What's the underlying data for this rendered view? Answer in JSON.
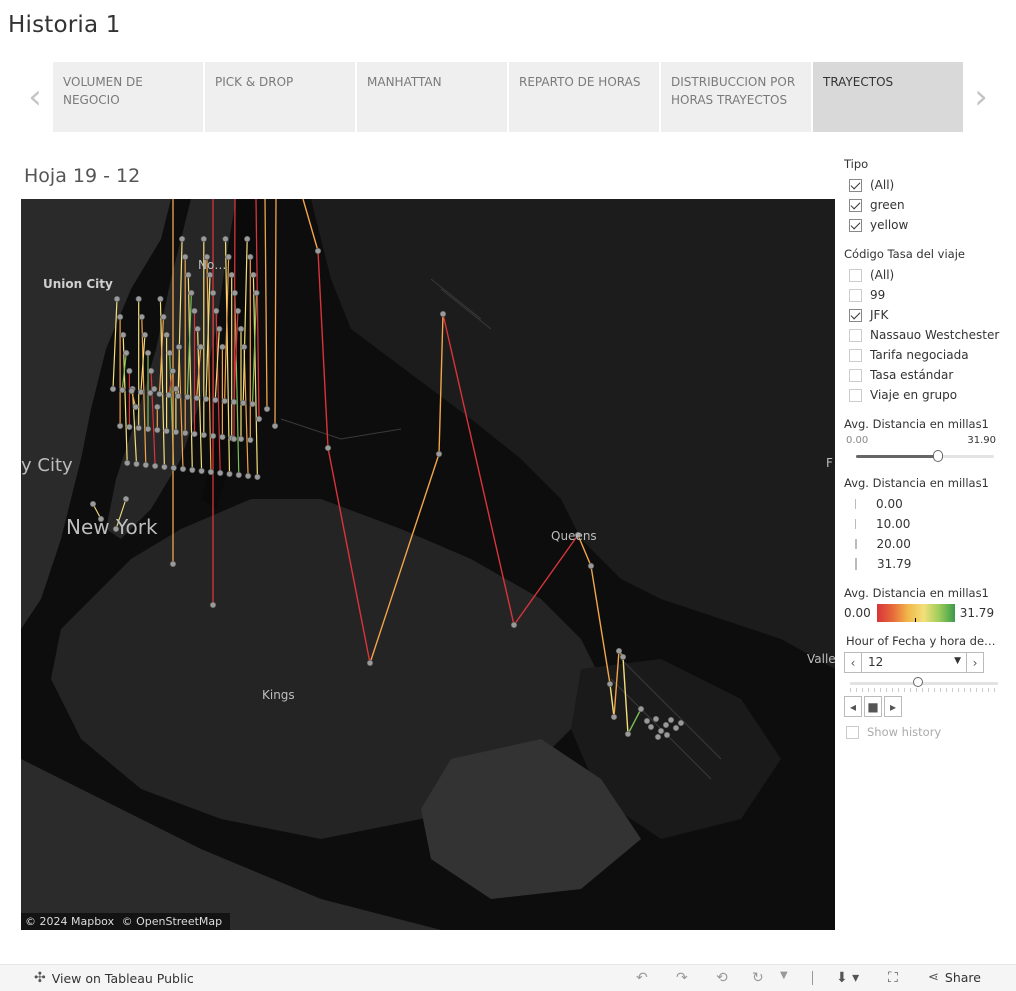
{
  "story": {
    "title": "Historia 1"
  },
  "nav": {
    "prev_icon": "chevron-left-icon",
    "next_icon": "chevron-right-icon"
  },
  "tabs": [
    {
      "label": "VOLUMEN DE NEGOCIO",
      "active": false
    },
    {
      "label": "PICK & DROP",
      "active": false
    },
    {
      "label": "MANHATTAN",
      "active": false
    },
    {
      "label": "REPARTO DE HORAS",
      "active": false
    },
    {
      "label": "DISTRIBUCCION POR HORAS TRAYECTOS",
      "active": false
    },
    {
      "label": "TRAYECTOS",
      "active": true
    }
  ],
  "sheet": {
    "title": "Hoja 19 - 12"
  },
  "map": {
    "labels": {
      "union_city": "Union City",
      "city": "y City",
      "new_york": "New York",
      "queens": "Queens",
      "kings": "Kings",
      "valle": "Valle",
      "f": "F",
      "north": "No…"
    },
    "attribution": {
      "mapbox": "© 2024 Mapbox",
      "osm": "© OpenStreetMap"
    },
    "colors": {
      "background": "#0d0d0d",
      "land": "#2a2a2a",
      "water": "#000000",
      "red": "#d9343a",
      "orange": "#f2a54a",
      "yellow": "#f3e07a",
      "green": "#7cbf55",
      "point": "#9a9a9a"
    }
  },
  "filters": {
    "tipo": {
      "heading": "Tipo",
      "options": [
        {
          "label": "(All)",
          "checked": true
        },
        {
          "label": "green",
          "checked": true
        },
        {
          "label": "yellow",
          "checked": true
        }
      ]
    },
    "codigo": {
      "heading": "Código Tasa del viaje",
      "options": [
        {
          "label": "(All)",
          "checked": false
        },
        {
          "label": "99",
          "checked": false
        },
        {
          "label": "JFK",
          "checked": true
        },
        {
          "label": "Nassauo Westchester",
          "checked": false
        },
        {
          "label": "Tarifa negociada",
          "checked": false
        },
        {
          "label": "Tasa estándar",
          "checked": false
        },
        {
          "label": "Viaje en grupo",
          "checked": false
        }
      ]
    },
    "distancia_range": {
      "heading": "Avg. Distancia en millas1",
      "min": "0.00",
      "max": "31.90",
      "value_fraction": 0.63
    },
    "size_legend": {
      "heading": "Avg. Distancia en millas1",
      "items": [
        "0.00",
        "10.00",
        "20.00",
        "31.79"
      ]
    },
    "color_legend": {
      "heading": "Avg. Distancia en millas1",
      "min": "0.00",
      "max": "31.79"
    },
    "hour": {
      "heading": "Hour of Fecha y hora de…",
      "value": "12",
      "slider_fraction": 0.5,
      "show_history": "Show history"
    }
  },
  "toolbar": {
    "view_label": "View on Tableau Public",
    "share_label": "Share"
  }
}
